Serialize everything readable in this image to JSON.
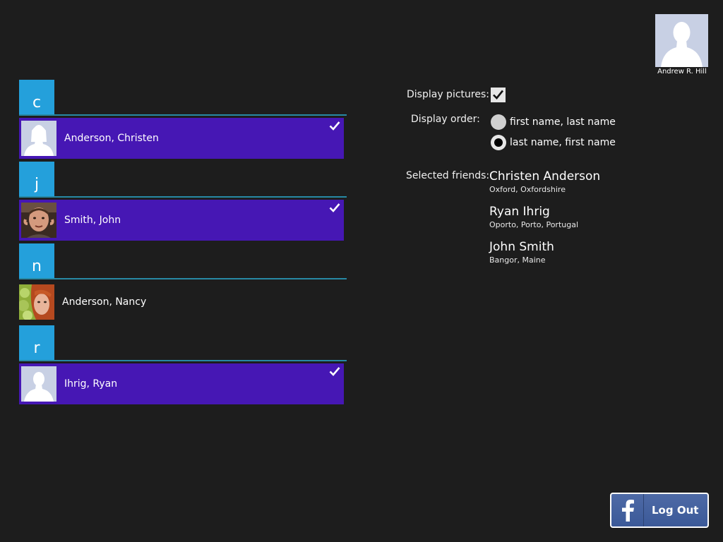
{
  "current_user": {
    "name": "Andrew R. Hill",
    "picture_icon": "silhouette-male-icon"
  },
  "friend_groups": [
    {
      "letter": "c",
      "friends": [
        {
          "name": "Anderson, Christen",
          "selected": true,
          "avatar": "silhouette-female-icon"
        }
      ]
    },
    {
      "letter": "j",
      "friends": [
        {
          "name": "Smith, John",
          "selected": true,
          "avatar": "photo-man-icon"
        }
      ]
    },
    {
      "letter": "n",
      "friends": [
        {
          "name": "Anderson, Nancy",
          "selected": false,
          "avatar": "photo-woman-icon"
        }
      ]
    },
    {
      "letter": "r",
      "friends": [
        {
          "name": "Ihrig, Ryan",
          "selected": true,
          "avatar": "silhouette-male-icon"
        }
      ]
    }
  ],
  "settings": {
    "display_pictures_label": "Display pictures:",
    "display_pictures_checked": true,
    "display_order_label": "Display order:",
    "order_options": [
      {
        "label": "first name, last name",
        "selected": false
      },
      {
        "label": "last name, first name",
        "selected": true
      }
    ],
    "selected_friends_label": "Selected friends:"
  },
  "selected_friends": [
    {
      "name": "Christen Anderson",
      "location": "Oxford, Oxfordshire"
    },
    {
      "name": "Ryan Ihrig",
      "location": "Oporto, Porto, Portugal"
    },
    {
      "name": "John Smith",
      "location": "Bangor, Maine"
    }
  ],
  "logout": {
    "label": "Log Out",
    "icon": "facebook-f-icon"
  },
  "colors": {
    "background": "#1d1d1d",
    "letter_tile": "#24a0db",
    "selected_row": "#4617b4",
    "divider": "#2789a5",
    "facebook_blue": "#3b5998"
  }
}
